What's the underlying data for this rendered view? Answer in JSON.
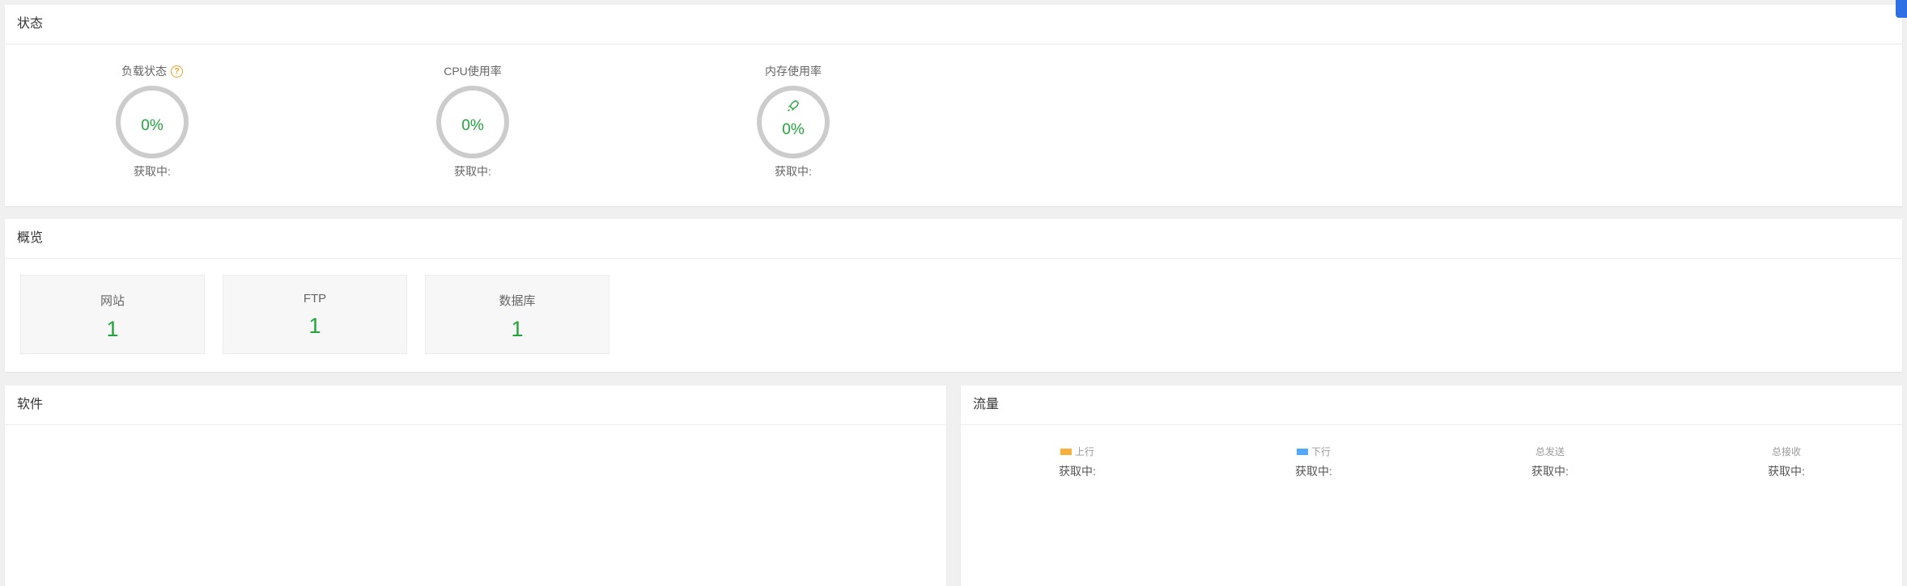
{
  "status": {
    "title": "状态",
    "gauges": [
      {
        "label": "负载状态",
        "value": "0%",
        "sub": "获取中:"
      },
      {
        "label": "CPU使用率",
        "value": "0%",
        "sub": "获取中:"
      },
      {
        "label": "内存使用率",
        "value": "0%",
        "sub": "获取中:"
      }
    ],
    "help_icon_glyph": "?",
    "ring_color": "#cccccc",
    "value_color": "#20a53a"
  },
  "overview": {
    "title": "概览",
    "cards": [
      {
        "label": "网站",
        "value": "1"
      },
      {
        "label": "FTP",
        "value": "1"
      },
      {
        "label": "数据库",
        "value": "1"
      }
    ]
  },
  "software": {
    "title": "软件"
  },
  "traffic": {
    "title": "流量",
    "columns": [
      {
        "label": "上行",
        "value": "获取中:",
        "swatch": "#f7b03c"
      },
      {
        "label": "下行",
        "value": "获取中:",
        "swatch": "#52a9ff"
      },
      {
        "label": "总发送",
        "value": "获取中:"
      },
      {
        "label": "总接收",
        "value": "获取中:"
      }
    ]
  },
  "icons": {
    "help": "question-circle-icon",
    "rocket": "rocket-icon",
    "edge": "floating-tool-icon"
  }
}
